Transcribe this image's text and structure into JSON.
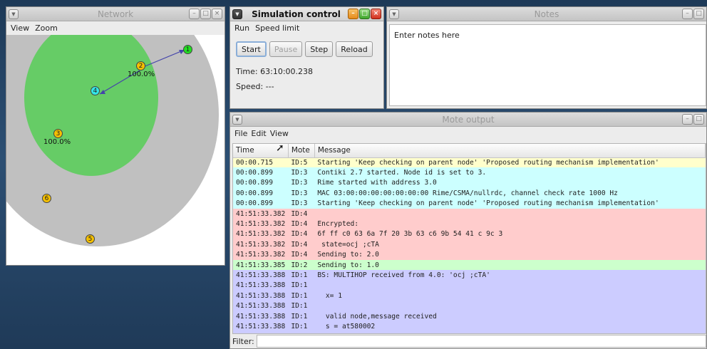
{
  "network": {
    "title": "Network",
    "menu": [
      "View",
      "Zoom"
    ],
    "nodes": [
      {
        "id": "1",
        "color": "#22dd22"
      },
      {
        "id": "2",
        "color": "#f5c000",
        "label": "100.0%"
      },
      {
        "id": "3",
        "color": "#f5c000",
        "label": "100.0%"
      },
      {
        "id": "4",
        "color": "#33e6e6"
      },
      {
        "id": "5",
        "color": "#f5c000"
      },
      {
        "id": "6",
        "color": "#f5c000"
      }
    ],
    "colors": {
      "range_outer": "#c0c0c0",
      "range_inner": "#66cc66",
      "link": "#4444aa"
    }
  },
  "simctl": {
    "title": "Simulation control",
    "menu": [
      "Run",
      "Speed limit"
    ],
    "buttons": [
      "Start",
      "Pause",
      "Step",
      "Reload"
    ],
    "time": "Time: 63:10:00.238",
    "speed": "Speed: ---"
  },
  "notes": {
    "title": "Notes",
    "text": "Enter notes here"
  },
  "mote_output": {
    "title": "Mote output",
    "menu": [
      "File",
      "Edit",
      "View"
    ],
    "columns": [
      "Time",
      "Mote",
      "Message"
    ],
    "rows": [
      {
        "time": "00:00.715",
        "mote": "ID:5",
        "msg": "Starting 'Keep checking on parent node' 'Proposed routing mechanism implementation'",
        "bg": "#ffffcc"
      },
      {
        "time": "00:00.899",
        "mote": "ID:3",
        "msg": "Contiki 2.7 started. Node id is set to 3.",
        "bg": "#ccffff"
      },
      {
        "time": "00:00.899",
        "mote": "ID:3",
        "msg": "Rime started with address 3.0",
        "bg": "#ccffff"
      },
      {
        "time": "00:00.899",
        "mote": "ID:3",
        "msg": "MAC 03:00:00:00:00:00:00:00 Rime/CSMA/nullrdc, channel check rate 1000 Hz",
        "bg": "#ccffff"
      },
      {
        "time": "00:00.899",
        "mote": "ID:3",
        "msg": "Starting 'Keep checking on parent node' 'Proposed routing mechanism implementation'",
        "bg": "#ccffff"
      },
      {
        "time": "41:51:33.382",
        "mote": "ID:4",
        "msg": "",
        "bg": "#ffcccc"
      },
      {
        "time": "41:51:33.382",
        "mote": "ID:4",
        "msg": "Encrypted:",
        "bg": "#ffcccc"
      },
      {
        "time": "41:51:33.382",
        "mote": "ID:4",
        "msg": "6f ff c0 63 6a 7f 20 3b 63 c6 9b 54 41 c 9c 3",
        "bg": "#ffcccc"
      },
      {
        "time": "41:51:33.382",
        "mote": "ID:4",
        "msg": " state=ocj ;cTA",
        "bg": "#ffcccc"
      },
      {
        "time": "41:51:33.382",
        "mote": "ID:4",
        "msg": "Sending to: 2.0",
        "bg": "#ffcccc"
      },
      {
        "time": "41:51:33.385",
        "mote": "ID:2",
        "msg": "Sending to: 1.0",
        "bg": "#ccffcc"
      },
      {
        "time": "41:51:33.388",
        "mote": "ID:1",
        "msg": "BS: MULTIHOP received from 4.0: 'ocj ;cTA'",
        "bg": "#ccccff"
      },
      {
        "time": "41:51:33.388",
        "mote": "ID:1",
        "msg": "",
        "bg": "#ccccff"
      },
      {
        "time": "41:51:33.388",
        "mote": "ID:1",
        "msg": "  x= 1",
        "bg": "#ccccff"
      },
      {
        "time": "41:51:33.388",
        "mote": "ID:1",
        "msg": "",
        "bg": "#ccccff"
      },
      {
        "time": "41:51:33.388",
        "mote": "ID:1",
        "msg": "  valid node,message received",
        "bg": "#ccccff"
      },
      {
        "time": "41:51:33.388",
        "mote": "ID:1",
        "msg": "  s = at580002",
        "bg": "#ccccff"
      },
      {
        "time": "",
        "mote": "",
        "msg": "",
        "bg": "#ccccff"
      }
    ],
    "filter_label": "Filter:"
  }
}
